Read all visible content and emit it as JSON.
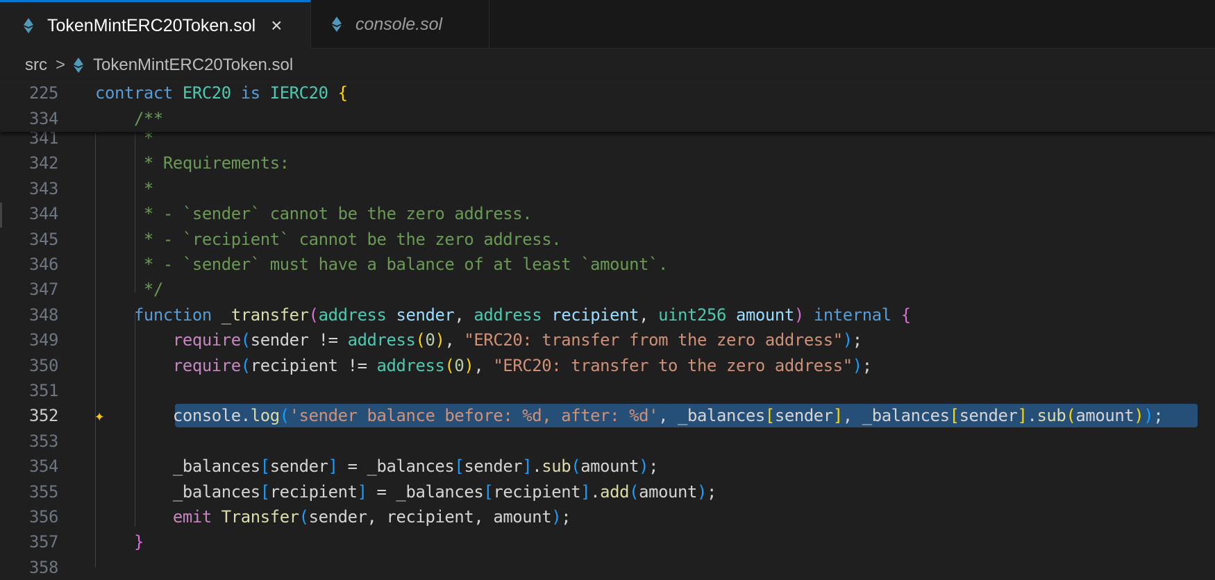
{
  "tabs": [
    {
      "label": "TokenMintERC20Token.sol",
      "active": true,
      "close_icon": "×"
    },
    {
      "label": "console.sol",
      "active": false
    }
  ],
  "breadcrumb": {
    "folder": "src",
    "separator": ">",
    "file": "TokenMintERC20Token.sol"
  },
  "colors": {
    "accent": "#0078d4",
    "selection": "#264f78",
    "ethereum_icon": "#519aba"
  },
  "sticky_lines": [
    {
      "n": "225",
      "tokens": [
        [
          "contract",
          "kw"
        ],
        [
          " ",
          "pl"
        ],
        [
          "ERC20",
          "ty"
        ],
        [
          " ",
          "pl"
        ],
        [
          "is",
          "kw"
        ],
        [
          " ",
          "pl"
        ],
        [
          "IERC20",
          "ty"
        ],
        [
          " ",
          "pl"
        ],
        [
          "{",
          "b1"
        ]
      ]
    },
    {
      "n": "334",
      "tokens": [
        [
          "    ",
          "pl"
        ],
        [
          "/**",
          "cm"
        ]
      ]
    }
  ],
  "lines": [
    {
      "n": "341",
      "tokens": [
        [
          "     *",
          "cm"
        ]
      ]
    },
    {
      "n": "342",
      "tokens": [
        [
          "     * Requirements:",
          "cm"
        ]
      ]
    },
    {
      "n": "343",
      "tokens": [
        [
          "     *",
          "cm"
        ]
      ]
    },
    {
      "n": "344",
      "tokens": [
        [
          "     * - `sender` cannot be the zero address.",
          "cm"
        ]
      ]
    },
    {
      "n": "345",
      "tokens": [
        [
          "     * - `recipient` cannot be the zero address.",
          "cm"
        ]
      ]
    },
    {
      "n": "346",
      "tokens": [
        [
          "     * - `sender` must have a balance of at least `amount`.",
          "cm"
        ]
      ]
    },
    {
      "n": "347",
      "tokens": [
        [
          "     */",
          "cm"
        ]
      ]
    },
    {
      "n": "348",
      "tokens": [
        [
          "    ",
          "pl"
        ],
        [
          "function",
          "kw"
        ],
        [
          " ",
          "pl"
        ],
        [
          "_transfer",
          "fn"
        ],
        [
          "(",
          "b2"
        ],
        [
          "address",
          "ty"
        ],
        [
          " ",
          "pl"
        ],
        [
          "sender",
          "pv"
        ],
        [
          ", ",
          "pl"
        ],
        [
          "address",
          "ty"
        ],
        [
          " ",
          "pl"
        ],
        [
          "recipient",
          "pv"
        ],
        [
          ", ",
          "pl"
        ],
        [
          "uint256",
          "ty"
        ],
        [
          " ",
          "pl"
        ],
        [
          "amount",
          "pv"
        ],
        [
          ")",
          "b2"
        ],
        [
          " ",
          "pl"
        ],
        [
          "internal",
          "kw"
        ],
        [
          " ",
          "pl"
        ],
        [
          "{",
          "b2"
        ]
      ]
    },
    {
      "n": "349",
      "tokens": [
        [
          "        ",
          "pl"
        ],
        [
          "require",
          "ctl"
        ],
        [
          "(",
          "b3"
        ],
        [
          "sender != ",
          "pl"
        ],
        [
          "address",
          "ty"
        ],
        [
          "(",
          "b1"
        ],
        [
          "0",
          "num"
        ],
        [
          ")",
          "b1"
        ],
        [
          ", ",
          "pl"
        ],
        [
          "\"ERC20: transfer from the zero address\"",
          "st"
        ],
        [
          ")",
          "b3"
        ],
        [
          ";",
          "pl"
        ]
      ]
    },
    {
      "n": "350",
      "tokens": [
        [
          "        ",
          "pl"
        ],
        [
          "require",
          "ctl"
        ],
        [
          "(",
          "b3"
        ],
        [
          "recipient != ",
          "pl"
        ],
        [
          "address",
          "ty"
        ],
        [
          "(",
          "b1"
        ],
        [
          "0",
          "num"
        ],
        [
          ")",
          "b1"
        ],
        [
          ", ",
          "pl"
        ],
        [
          "\"ERC20: transfer to the zero address\"",
          "st"
        ],
        [
          ")",
          "b3"
        ],
        [
          ";",
          "pl"
        ]
      ]
    },
    {
      "n": "351",
      "tokens": []
    },
    {
      "n": "352",
      "current": true,
      "selected": true,
      "tokens": [
        [
          "        ",
          "pl"
        ],
        [
          "console.",
          "pl"
        ],
        [
          "log",
          "fn"
        ],
        [
          "(",
          "b3"
        ],
        [
          "'sender balance before: %d, after: %d'",
          "st"
        ],
        [
          ", _balances",
          "pl"
        ],
        [
          "[",
          "b1"
        ],
        [
          "sender",
          "pl"
        ],
        [
          "]",
          "b1"
        ],
        [
          ", _balances",
          "pl"
        ],
        [
          "[",
          "b1"
        ],
        [
          "sender",
          "pl"
        ],
        [
          "]",
          "b1"
        ],
        [
          ".",
          "pl"
        ],
        [
          "sub",
          "fn"
        ],
        [
          "(",
          "b1"
        ],
        [
          "amount",
          "pl"
        ],
        [
          ")",
          "b1"
        ],
        [
          ")",
          "b3"
        ],
        [
          ";",
          "pl"
        ]
      ]
    },
    {
      "n": "353",
      "tokens": []
    },
    {
      "n": "354",
      "tokens": [
        [
          "        _balances",
          "pl"
        ],
        [
          "[",
          "b3"
        ],
        [
          "sender",
          "pl"
        ],
        [
          "]",
          "b3"
        ],
        [
          " = _balances",
          "pl"
        ],
        [
          "[",
          "b3"
        ],
        [
          "sender",
          "pl"
        ],
        [
          "]",
          "b3"
        ],
        [
          ".",
          "pl"
        ],
        [
          "sub",
          "fn"
        ],
        [
          "(",
          "b3"
        ],
        [
          "amount",
          "pl"
        ],
        [
          ")",
          "b3"
        ],
        [
          ";",
          "pl"
        ]
      ]
    },
    {
      "n": "355",
      "tokens": [
        [
          "        _balances",
          "pl"
        ],
        [
          "[",
          "b3"
        ],
        [
          "recipient",
          "pl"
        ],
        [
          "]",
          "b3"
        ],
        [
          " = _balances",
          "pl"
        ],
        [
          "[",
          "b3"
        ],
        [
          "recipient",
          "pl"
        ],
        [
          "]",
          "b3"
        ],
        [
          ".",
          "pl"
        ],
        [
          "add",
          "fn"
        ],
        [
          "(",
          "b3"
        ],
        [
          "amount",
          "pl"
        ],
        [
          ")",
          "b3"
        ],
        [
          ";",
          "pl"
        ]
      ]
    },
    {
      "n": "356",
      "tokens": [
        [
          "        ",
          "pl"
        ],
        [
          "emit",
          "ctl"
        ],
        [
          " ",
          "pl"
        ],
        [
          "Transfer",
          "fn"
        ],
        [
          "(",
          "b3"
        ],
        [
          "sender, recipient, amount",
          "pl"
        ],
        [
          ")",
          "b3"
        ],
        [
          ";",
          "pl"
        ]
      ]
    },
    {
      "n": "357",
      "tokens": [
        [
          "    ",
          "pl"
        ],
        [
          "}",
          "b2"
        ]
      ]
    },
    {
      "n": "358",
      "tokens": []
    }
  ]
}
